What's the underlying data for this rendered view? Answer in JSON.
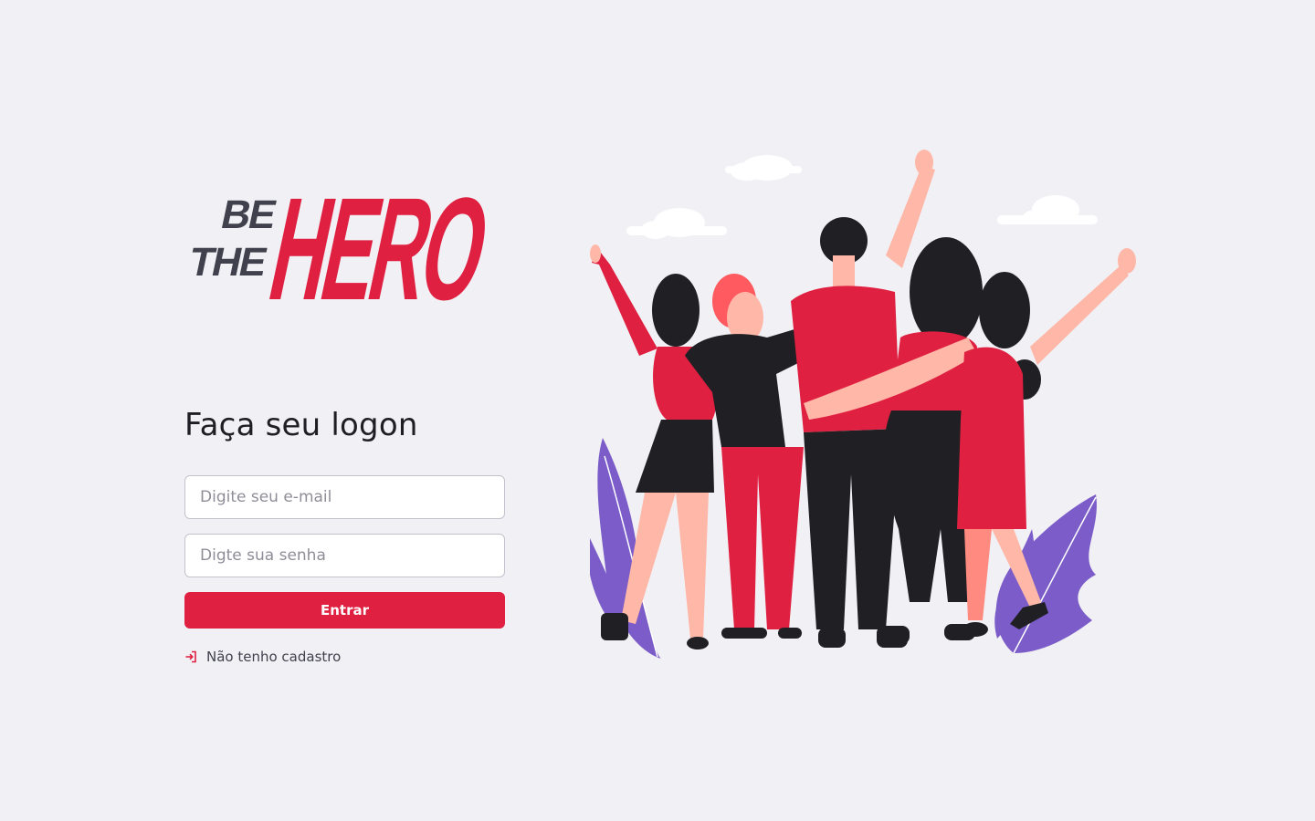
{
  "brand": {
    "logo_line1": "BE",
    "logo_line2": "THE",
    "logo_word": "HERO",
    "primary_color": "#e02041",
    "dark_color": "#41414d",
    "background_color": "#f0f0f5"
  },
  "logon": {
    "title": "Faça seu logon",
    "email_placeholder": "Digite seu e-mail",
    "password_placeholder": "Digte sua senha",
    "submit_label": "Entrar",
    "register_link_label": "Não tenho cadastro",
    "register_link_icon": "log-in-icon"
  },
  "illustration": {
    "name": "heroes-group-illustration",
    "accent_colors": [
      "#e02041",
      "#202024",
      "#7b5cc8",
      "#ffb8a8"
    ]
  }
}
